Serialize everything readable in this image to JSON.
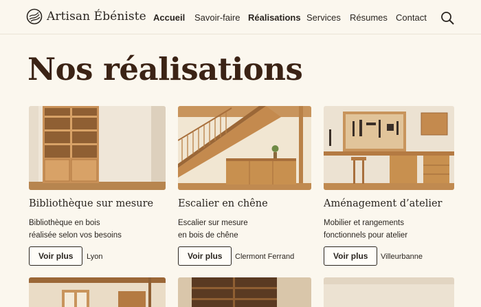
{
  "brand": {
    "name": "Artisan Ébéniste",
    "logo_icon": "wood-grain-logo-icon"
  },
  "nav": {
    "items": [
      "Accueil",
      "Savoir-faire",
      "Réalisations",
      "Services",
      "Résumes",
      "Contact"
    ],
    "active": "Réalisations",
    "search_icon": "search-icon"
  },
  "page": {
    "title": "Nos réalisations"
  },
  "projects": [
    {
      "title": "Bibliothèque sur mesure",
      "desc_line1": "Bibliothèque en bois",
      "desc_line2": "réalisée selon vos besoins",
      "button": "Voir plus",
      "location": "Lyon"
    },
    {
      "title": "Escalier en chêne",
      "desc_line1": "Escalier sur mesure",
      "desc_line2": "en bois de chêne",
      "button": "Voir plus",
      "location": "Clermont Ferrand"
    },
    {
      "title": "Aménagement d’atelier",
      "desc_line1": "Mobilier et rangements",
      "desc_line2": "fonctionnels pour atelier",
      "button": "Voir plus",
      "location": "Villeurbanne"
    }
  ],
  "colors": {
    "background": "#fbf7ee",
    "title": "#3b2315",
    "text": "#2a2520",
    "wood": "#c48a4e"
  }
}
